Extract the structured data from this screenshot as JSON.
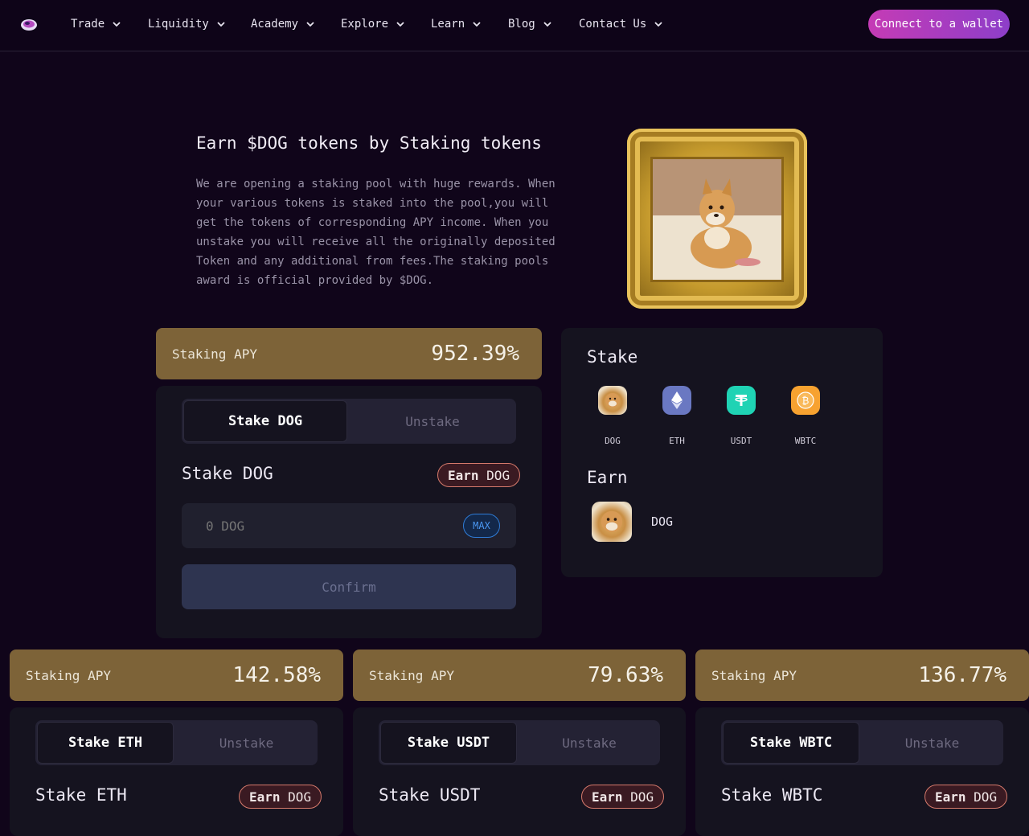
{
  "nav": {
    "items": [
      "Trade",
      "Liquidity",
      "Academy",
      "Explore",
      "Learn",
      "Blog",
      "Contact Us"
    ],
    "connect_label": "Connect to a wallet"
  },
  "hero": {
    "title": "Earn $DOG tokens by Staking tokens",
    "description": "We are opening a staking pool with huge rewards. When your various tokens is staked into the pool,you will get the tokens of corresponding APY income. When you unstake you will receive all the originally deposited Token and any additional from fees.The staking pools award is official provided by $DOG."
  },
  "main_pool": {
    "apy_label": "Staking APY",
    "apy_value": "952.39%",
    "tab_stake": "Stake DOG",
    "tab_unstake": "Unstake",
    "stake_label": "Stake DOG",
    "earn_word": "Earn",
    "earn_token": "DOG",
    "amount_placeholder": "0 DOG",
    "max_label": "MAX",
    "confirm_label": "Confirm"
  },
  "stake_panel": {
    "stake_title": "Stake",
    "tokens": [
      "DOG",
      "ETH",
      "USDT",
      "WBTC"
    ],
    "earn_title": "Earn",
    "earn_token": "DOG"
  },
  "pools": [
    {
      "apy_label": "Staking APY",
      "apy_value": "142.58%",
      "tab_stake": "Stake ETH",
      "tab_unstake": "Unstake",
      "stake_label": "Stake ETH",
      "earn_word": "Earn",
      "earn_token": "DOG"
    },
    {
      "apy_label": "Staking APY",
      "apy_value": "79.63%",
      "tab_stake": "Stake USDT",
      "tab_unstake": "Unstake",
      "stake_label": "Stake USDT",
      "earn_word": "Earn",
      "earn_token": "DOG"
    },
    {
      "apy_label": "Staking APY",
      "apy_value": "136.77%",
      "tab_stake": "Stake WBTC",
      "tab_unstake": "Unstake",
      "stake_label": "Stake WBTC",
      "earn_word": "Earn",
      "earn_token": "DOG"
    }
  ],
  "colors": {
    "background": "#10051a",
    "apy_bar": "#7d6338",
    "card": "#15131f",
    "connect_gradient_start": "#c53bb5",
    "connect_gradient_end": "#8d3ec9",
    "max_accent": "#2f7cd6",
    "earn_border": "#d67a6c"
  },
  "icons": {
    "logo": "brand-logo-icon",
    "chevron": "chevron-down-icon",
    "dog": "doge-avatar-icon",
    "eth": "ethereum-icon",
    "usdt": "tether-icon",
    "wbtc": "bitcoin-icon"
  }
}
